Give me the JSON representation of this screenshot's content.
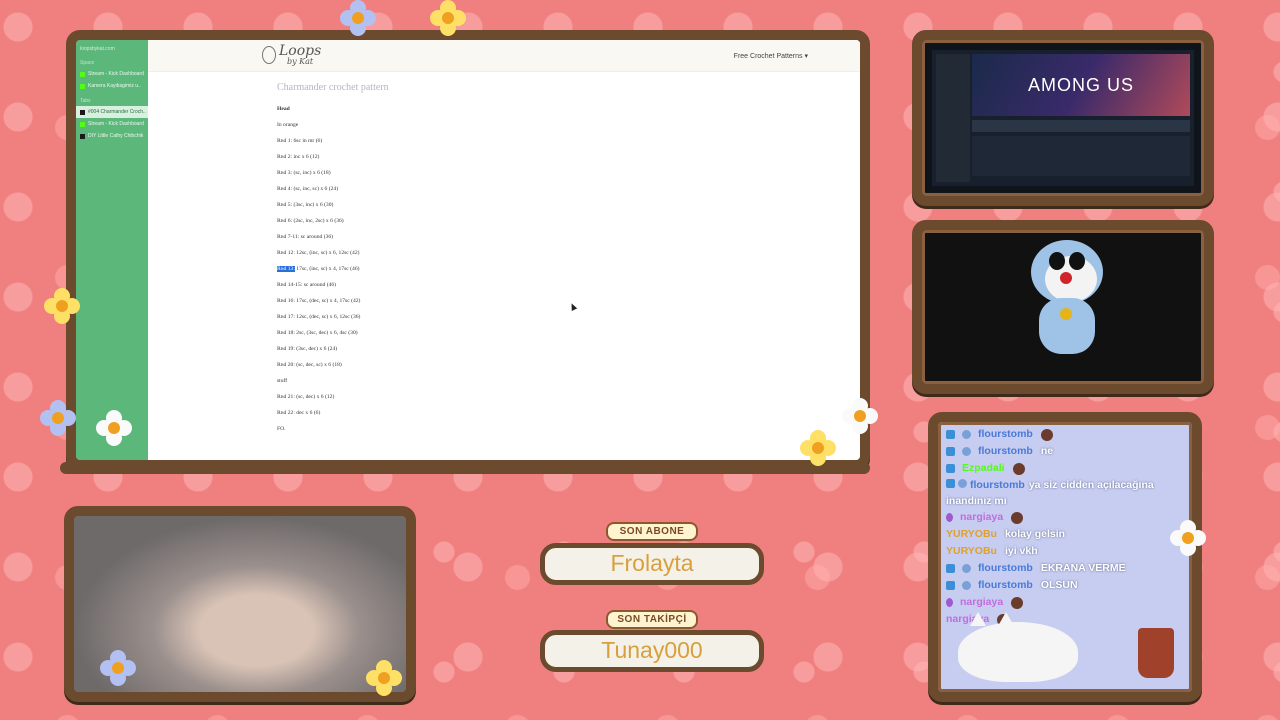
{
  "browser": {
    "sidebar": {
      "url": "loopsbykat.com",
      "section_1": "Space",
      "section_2": "Tabs",
      "items": [
        {
          "label": "Stream - Kick Dashboard",
          "favicon": "kick-icon"
        },
        {
          "label": "Kamera Kaydiagimiz u..",
          "favicon": "kick-icon"
        },
        {
          "label": "#004 Charmander Croch..",
          "favicon": "page-icon",
          "active": true
        },
        {
          "label": "Stream - Kick Dashboard",
          "favicon": "kick-icon"
        },
        {
          "label": "DIY Little Cathy Chibchik",
          "favicon": "page-icon"
        }
      ]
    },
    "site": {
      "logo_big": "Loops",
      "logo_small": "by Kat",
      "nav_label": "Free Crochet Patterns ▾"
    },
    "article": {
      "title": "Charmander crochet pattern",
      "lines": [
        "Head",
        "In orange",
        "Rnd 1: 6sc in mr (6)",
        "Rnd 2: inc x 6 (12)",
        "Rnd 3: (sc, inc) x 6 (18)",
        "Rnd 4: (sc, inc, sc) x 6 (24)",
        "Rnd 5: (3sc, inc) x 6 (30)",
        "Rnd 6: (2sc, inc, 2sc) x 6 (36)",
        "Rnd 7-11: sc around (36)",
        "Rnd 12: 12sc, (inc, sc) x 6, 12sc (42)",
        "17sc, (inc, sc) x 4, 17sc (46)",
        "Rnd 14-15: sc around (46)",
        "Rnd 16: 17sc, (dec, sc) x 4, 17sc (42)",
        "Rnd 17: 12sc, (dec, sc) x 6, 12sc (36)",
        "Rnd 18: 2sc, (3sc, dec) x 6, 4sc (30)",
        "Rnd 19: (3sc, dec) x 6 (24)",
        "Rnd 20: (sc, dec, sc) x 6 (18)",
        "stuff",
        "Rnd 21: (sc, dec) x 6 (12)",
        "Rnd 22: dec x 6 (6)",
        "FO."
      ],
      "highlighted_prefix": "Rnd 13:"
    }
  },
  "game": {
    "title": "AMONG US"
  },
  "subscriber": {
    "label": "SON ABONE",
    "name": "Frolayta"
  },
  "follower": {
    "label": "SON TAKİPÇİ",
    "name": "Tunay000"
  },
  "chat": {
    "messages": [
      {
        "user": "flourstomb",
        "user_color": "#4a7ad8",
        "text": "",
        "emote": "emoji-icon",
        "badges": [
          "kick-badge",
          "gear-badge"
        ]
      },
      {
        "user": "flourstomb",
        "user_color": "#4a7ad8",
        "text": "ne",
        "badges": [
          "kick-badge",
          "gear-badge"
        ]
      },
      {
        "user": "Ezpadali",
        "user_color": "#53fc18",
        "text": "",
        "emote": "emoji-icon",
        "badges": [
          "kick-badge"
        ]
      },
      {
        "user": "flourstomb",
        "user_color": "#4a7ad8",
        "text": "ya siz cidden açılacağına inandınız mı",
        "badges": [
          "kick-badge",
          "gear-badge"
        ]
      },
      {
        "user": "nargiaya",
        "user_color": "#c46be0",
        "text": "",
        "emote": "emoji-icon",
        "badges": [
          "mic-badge"
        ]
      },
      {
        "user": "YURYOBu",
        "user_color": "#e0a030",
        "text": "kolay gelsin",
        "badges": []
      },
      {
        "user": "YURYOBu",
        "user_color": "#e0a030",
        "text": "iyi vkh",
        "badges": []
      },
      {
        "user": "flourstomb",
        "user_color": "#4a7ad8",
        "text": "EKRANA VERME",
        "badges": [
          "kick-badge",
          "gear-badge"
        ]
      },
      {
        "user": "flourstomb",
        "user_color": "#4a7ad8",
        "text": "OLSUN",
        "badges": [
          "kick-badge",
          "gear-badge"
        ]
      },
      {
        "user": "nargiaya",
        "user_color": "#c46be0",
        "text": "",
        "emote": "emoji-icon",
        "badges": [
          "mic-badge"
        ]
      },
      {
        "user": "nargiaya",
        "user_color": "#c46be0",
        "text": "",
        "emote": "emoji-icon",
        "badges": []
      }
    ]
  },
  "colors": {
    "background": "#f08080",
    "wood": "#6b4a2e",
    "kick_green": "#53fc18",
    "highlight": "#2a6ed8"
  }
}
